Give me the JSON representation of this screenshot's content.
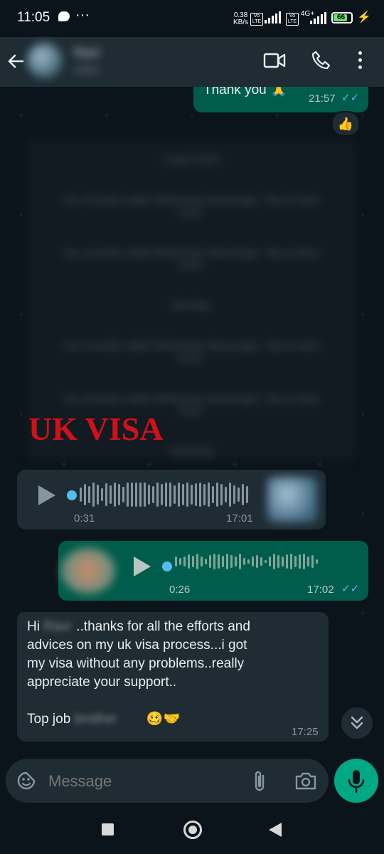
{
  "status_bar": {
    "time": "11:05",
    "net_speed_top": "0.38",
    "net_speed_bottom": "KB/s",
    "volte1": "Vo LTE",
    "volte2": "Vo LTE",
    "network": "4G+",
    "battery": "66"
  },
  "header": {
    "contact_name": "Ravi",
    "contact_sub": "online",
    "icons": [
      "back-arrow-icon",
      "video-call-icon",
      "phone-icon",
      "more-vert-icon"
    ]
  },
  "messages": {
    "thank_you": {
      "text": "Thank you 🙏",
      "time": "21:57"
    },
    "reaction": "👍",
    "blurred_card": {
      "header": "3 April 2023",
      "lines": [
        "You recently called WhatsApp Messenger. Tap to learn more.",
        "You recently called WhatsApp Messenger. Tap to learn more.",
        "Monday",
        "You recently called WhatsApp Messenger. Tap to learn more.",
        "You recently called WhatsApp Messenger. Tap to learn more.",
        "Yesterday"
      ]
    },
    "overlay_label": "UK VISA",
    "voice_in": {
      "duration": "0:31",
      "time": "17:01"
    },
    "voice_out": {
      "duration": "0:26",
      "time": "17:02"
    },
    "text_in": {
      "greeting": "Hi",
      "name": "Ravi",
      "line1": "..thanks for all the efforts and",
      "line2": "advices on my uk visa process...i got",
      "line3": "my visa without any problems..really",
      "line4": "appreciate your support..",
      "top_job": "Top job",
      "top_job_name": "brother",
      "emoji": "🥴🤝",
      "time": "17:25"
    }
  },
  "composer": {
    "placeholder": "Message"
  },
  "colors": {
    "accent": "#00a884",
    "outgoing_bubble": "#005c4b",
    "incoming_bubble": "#202c33",
    "tick_blue": "#53bdeb",
    "overlay_red": "#d3101a"
  }
}
